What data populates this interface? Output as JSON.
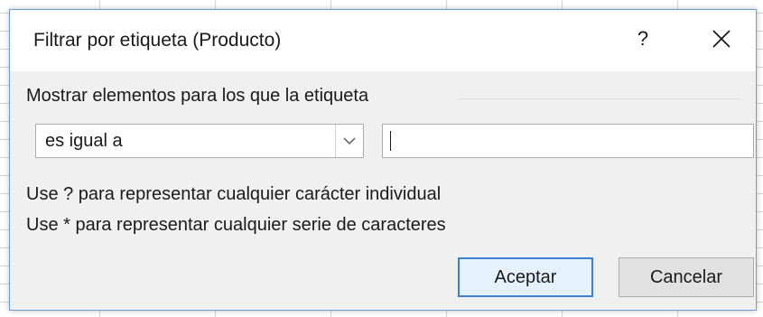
{
  "dialog": {
    "title": "Filtrar por etiqueta (Producto)",
    "help_label": "?",
    "group_label": "Mostrar elementos para los que la etiqueta",
    "condition": {
      "selected": "es igual a"
    },
    "value_input": {
      "value": ""
    },
    "hints": [
      "Use ? para representar cualquier carácter individual",
      "Use * para representar cualquier serie de caracteres"
    ],
    "ok_label": "Aceptar",
    "cancel_label": "Cancelar"
  },
  "icons": {
    "close": "close-icon",
    "dropdown": "chevron-down-icon"
  },
  "colors": {
    "dialog_background": "#f0f0f0",
    "accent_border": "#3c7fd6"
  }
}
